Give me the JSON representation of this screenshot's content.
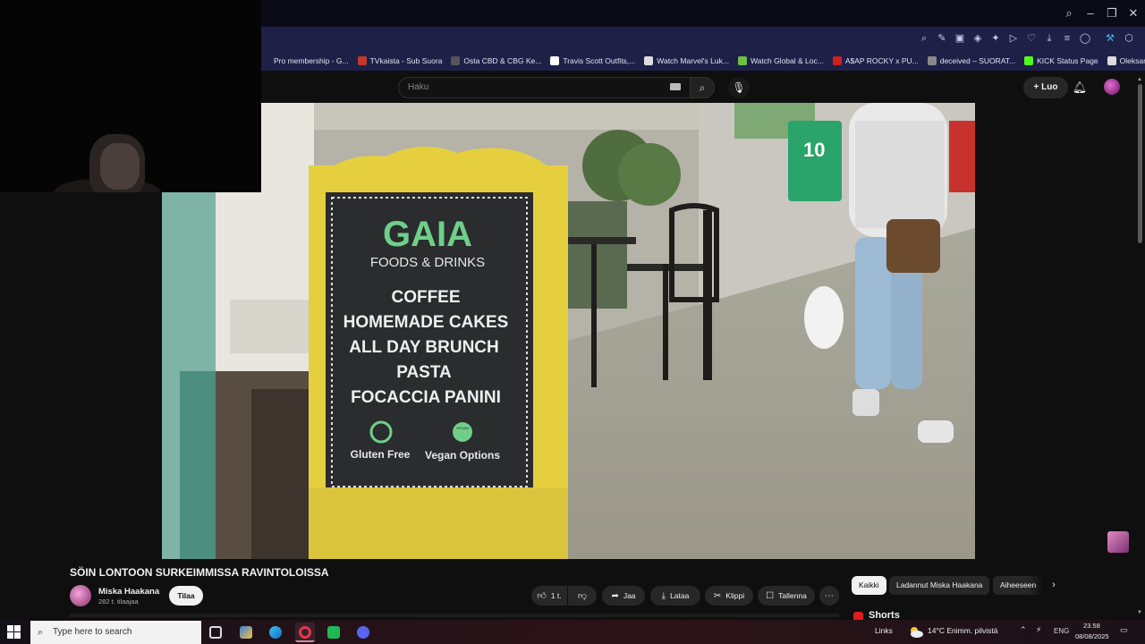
{
  "bookmarks": [
    {
      "label": "Pro membership - G...",
      "color": "#1e2048"
    },
    {
      "label": "TVkaista - Sub Suora",
      "color": "#c0392b"
    },
    {
      "label": "Osta CBD & CBG Ke...",
      "color": "#555555"
    },
    {
      "label": "Travis Scott Outfits,...",
      "color": "#ffffff"
    },
    {
      "label": "Watch Marvel's Luk...",
      "color": "#dddddd"
    },
    {
      "label": "Watch Global & Loc...",
      "color": "#6dbf43"
    },
    {
      "label": "A$AP ROCKY x PU...",
      "color": "#cc2020"
    },
    {
      "label": "deceived – SUORAT...",
      "color": "#888888"
    },
    {
      "label": "KICK Status Page",
      "color": "#53fc18"
    },
    {
      "label": "Oleksandr Usyk vs D...",
      "color": "#dddddd"
    }
  ],
  "search": {
    "placeholder": "Haku"
  },
  "header": {
    "create_label": "Luo"
  },
  "video_scene": {
    "sign_title": "GAIA",
    "sign_subtitle": "FOODS & DRINKS",
    "menu_lines": [
      "COFFEE",
      "HOMEMADE CAKES",
      "ALL DAY BRUNCH",
      "PASTA",
      "FOCACCIA PANINI"
    ],
    "badge_left": "Gluten Free",
    "badge_right": "Vegan Options",
    "badge_right_small": "VEGAN",
    "bus_text": "10"
  },
  "video": {
    "title": "SÖIN LONTOON SURKEIMMISSA RAVINTOLOISSA",
    "channel": "Miska Haakana",
    "subscribers": "282 t. tilaajaa",
    "subscribe_label": "Tilaa"
  },
  "actions": {
    "likes": "1 t.",
    "share": "Jaa",
    "download": "Lataa",
    "clip": "Klippi",
    "save": "Tallenna"
  },
  "chips": [
    "Kaikki",
    "Ladannut Miska Haakana",
    "Aiheeseen"
  ],
  "shorts_label": "Shorts",
  "taskbar": {
    "search_placeholder": "Type here to search",
    "links": "Links",
    "weather": "14°C  Enimm. pilvistä",
    "lang": "ENG",
    "time": "23.58",
    "date": "08/08/2025"
  },
  "colors": {
    "accent": "#f1f1f1",
    "sign_green": "#6fcf8a",
    "sign_frame": "#e8d44d"
  }
}
